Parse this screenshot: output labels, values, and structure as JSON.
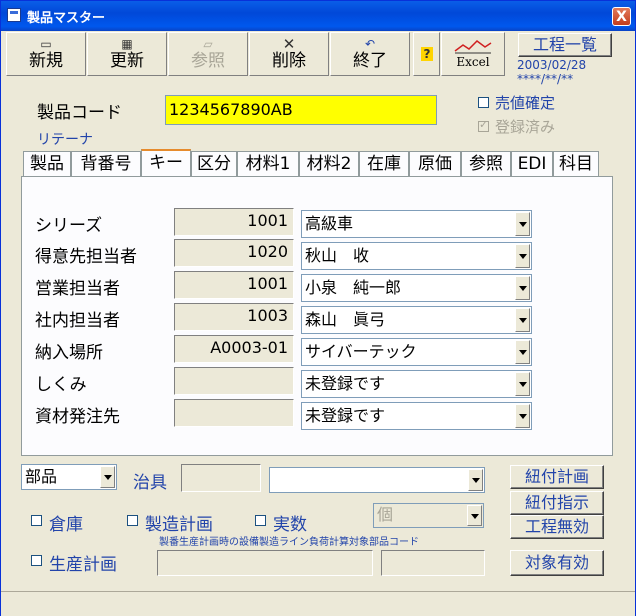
{
  "window": {
    "title": "製品マスター",
    "close_glyph": "X"
  },
  "toolbar": {
    "new": {
      "label": "新規",
      "icon": "new-doc-icon"
    },
    "update": {
      "label": "更新",
      "icon": "grid-icon"
    },
    "browse": {
      "label": "参照",
      "icon": "open-folder-icon"
    },
    "delete": {
      "label": "削除",
      "icon": "x-icon"
    },
    "exit": {
      "label": "終了",
      "icon": "return-icon"
    },
    "help_glyph": "?",
    "excel_label": "Excel",
    "process_list": "工程一覧",
    "date": "2003/02/28",
    "date_mask": "****/**/**"
  },
  "header": {
    "product_code_label": "製品コード",
    "product_code": "1234567890AB",
    "retainer_label": "リテーナ",
    "price_confirm_label": "売値確定",
    "registered_label": "登録済み"
  },
  "tabs": [
    "製品",
    "背番号",
    "キー",
    "区分",
    "材料1",
    "材料2",
    "在庫",
    "原価",
    "参照",
    "EDI",
    "科目"
  ],
  "key_panel": {
    "rows": [
      {
        "label": "シリーズ",
        "code": "1001",
        "value": "高級車"
      },
      {
        "label": "得意先担当者",
        "code": "1020",
        "value": "秋山　收"
      },
      {
        "label": "営業担当者",
        "code": "1001",
        "value": "小泉　純一郎"
      },
      {
        "label": "社内担当者",
        "code": "1003",
        "value": "森山　眞弓"
      },
      {
        "label": "納入場所",
        "code": "A0003-01",
        "value": "サイバーテック"
      },
      {
        "label": "しくみ",
        "code": "",
        "value": "未登録です"
      },
      {
        "label": "資材発注先",
        "code": "",
        "value": "未登録です"
      }
    ]
  },
  "bottom": {
    "part_select": "部品",
    "jig_label": "治具",
    "warehouse_label": "倉庫",
    "mfg_plan_label": "製造計画",
    "actual_qty_label": "実数",
    "unit_select": "個",
    "note": "製番生産計画時の設備製造ライン負荷計算対象部品コード",
    "prod_plan_label": "生産計画",
    "btn_link_plan": "紐付計画",
    "btn_link_instr": "紐付指示",
    "btn_process_disable": "工程無効",
    "btn_target_enable": "対象有効"
  },
  "colors": {
    "title_bar": "#0148d8",
    "code_field_bg": "#ffff00",
    "accent_blue": "#2244aa"
  }
}
